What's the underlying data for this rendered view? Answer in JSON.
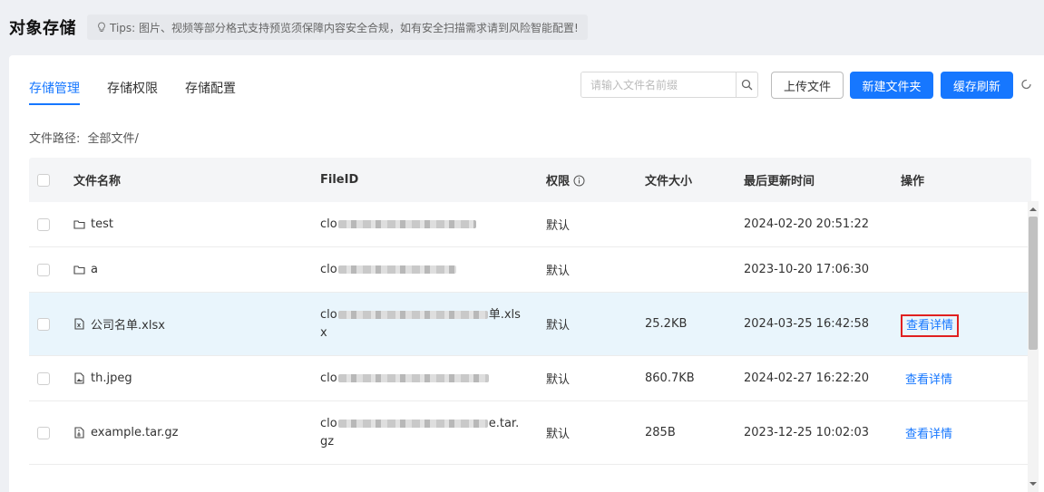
{
  "header": {
    "title": "对象存储",
    "tips": "Tips: 图片、视频等部分格式支持预览须保障内容安全合规，如有安全扫描需求请到风险智能配置!"
  },
  "tabs": [
    {
      "label": "存储管理",
      "active": true
    },
    {
      "label": "存储权限",
      "active": false
    },
    {
      "label": "存储配置",
      "active": false
    }
  ],
  "search": {
    "placeholder": "请输入文件名前缀",
    "value": ""
  },
  "toolbar": {
    "upload_label": "上传文件",
    "new_folder_label": "新建文件夹",
    "cache_refresh_label": "缓存刷新"
  },
  "path": {
    "label": "文件路径:",
    "value": "全部文件/"
  },
  "table": {
    "headers": {
      "name": "文件名称",
      "fileid": "FileID",
      "permission": "权限",
      "size": "文件大小",
      "updated": "最后更新时间",
      "actions": "操作"
    },
    "rows": [
      {
        "icon": "folder-icon",
        "name": "test",
        "fid_prefix": "clo",
        "fid_suffix": "",
        "fid_line2": "",
        "permission": "默认",
        "size": "",
        "updated": "2024-02-20 20:51:22",
        "action": ""
      },
      {
        "icon": "folder-icon",
        "name": "a",
        "fid_prefix": "clo",
        "fid_suffix": "",
        "fid_line2": "",
        "permission": "默认",
        "size": "",
        "updated": "2023-10-20 17:06:30",
        "action": ""
      },
      {
        "icon": "excel-file-icon",
        "name": "公司名单.xlsx",
        "fid_prefix": "clo",
        "fid_suffix": "单.xls",
        "fid_line2": "x",
        "permission": "默认",
        "size": "25.2KB",
        "updated": "2024-03-25 16:42:58",
        "action": "查看详情"
      },
      {
        "icon": "image-file-icon",
        "name": "th.jpeg",
        "fid_prefix": "clo",
        "fid_suffix": "",
        "fid_line2": "",
        "permission": "默认",
        "size": "860.7KB",
        "updated": "2024-02-27 16:22:20",
        "action": "查看详情"
      },
      {
        "icon": "archive-file-icon",
        "name": "example.tar.gz",
        "fid_prefix": "clo",
        "fid_suffix": "e.tar.",
        "fid_line2": "gz",
        "permission": "默认",
        "size": "285B",
        "updated": "2023-12-25 10:02:03",
        "action": "查看详情"
      }
    ]
  },
  "colors": {
    "primary": "#1677ff",
    "highlight_row": "#e9f5fc",
    "focus_border": "#e02020"
  }
}
